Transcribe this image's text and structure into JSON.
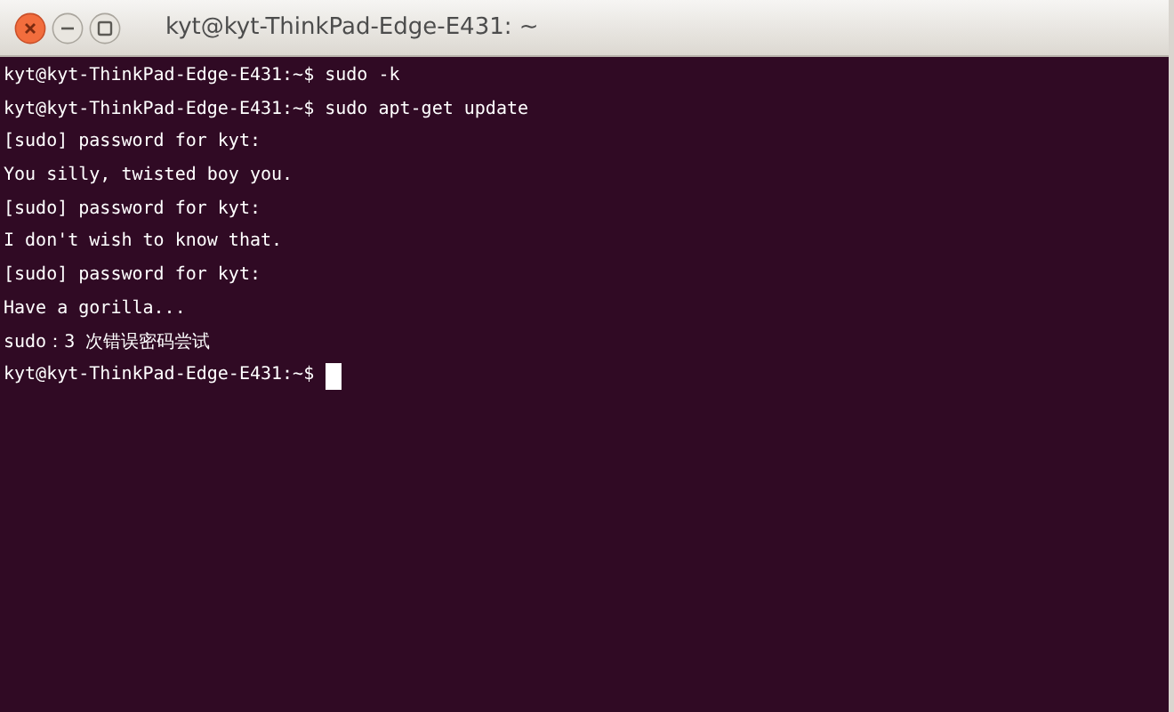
{
  "window": {
    "title": "kyt@kyt-ThinkPad-Edge-E431: ~",
    "controls": [
      {
        "kind": "close"
      },
      {
        "kind": "minimize"
      },
      {
        "kind": "maximize"
      }
    ]
  },
  "terminal": {
    "lines": [
      {
        "text": "kyt@kyt-ThinkPad-Edge-E431:~$ sudo -k",
        "cursor": false
      },
      {
        "text": "kyt@kyt-ThinkPad-Edge-E431:~$ sudo apt-get update",
        "cursor": false
      },
      {
        "text": "[sudo] password for kyt:",
        "cursor": false
      },
      {
        "text": "You silly, twisted boy you.",
        "cursor": false
      },
      {
        "text": "[sudo] password for kyt:",
        "cursor": false
      },
      {
        "text": "I don't wish to know that.",
        "cursor": false
      },
      {
        "text": "[sudo] password for kyt:",
        "cursor": false
      },
      {
        "text": "Have a gorilla...",
        "cursor": false
      },
      {
        "text": "sudo：3 次错误密码尝试",
        "cursor": false
      },
      {
        "text": "kyt@kyt-ThinkPad-Edge-E431:~$ ",
        "cursor": true
      }
    ]
  }
}
